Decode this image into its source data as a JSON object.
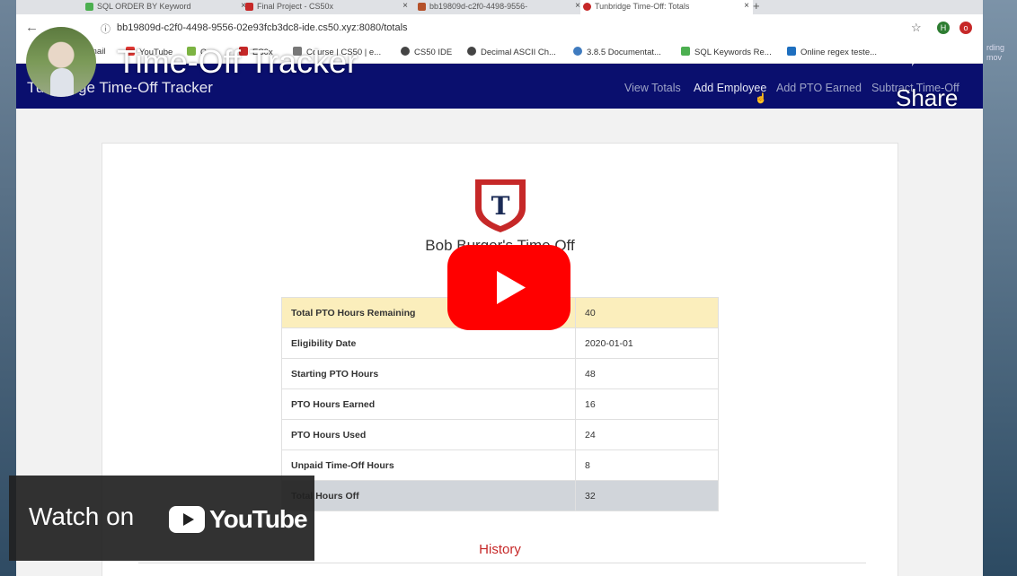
{
  "browser": {
    "tabs": [
      {
        "label": "SQL ORDER BY Keyword"
      },
      {
        "label": "Final Project - CS50x"
      },
      {
        "label": "bb19809d-c2f0-4498-9556-"
      },
      {
        "label": "Tunbridge Time-Off: Totals"
      }
    ],
    "url": "bb19809d-c2f0-4498-9556-02e93fcb3dc8-ide.cs50.xyz:8080/totals",
    "profile_initial": "H",
    "bookmarks": [
      {
        "label": "mail"
      },
      {
        "label": "YouTube"
      },
      {
        "label": "C"
      },
      {
        "label": "ES0x"
      },
      {
        "label": "Course | CS50 | e..."
      },
      {
        "label": "CS50 IDE"
      },
      {
        "label": "Decimal ASCII Ch..."
      },
      {
        "label": "3.8.5 Documentat..."
      },
      {
        "label": "SQL Keywords Re..."
      },
      {
        "label": "Online regex teste..."
      }
    ]
  },
  "site": {
    "brand": "Tunbridge Time-Off Tracker",
    "nav": [
      {
        "label": "View Totals"
      },
      {
        "label": "Add Employee"
      },
      {
        "label": "Add PTO Earned"
      },
      {
        "label": "Subtract Time-Off"
      }
    ],
    "logo_letter": "T",
    "employee_heading": "Bob Burger's Time Off",
    "rows": [
      {
        "label": "Total PTO Hours Remaining",
        "value": "40"
      },
      {
        "label": "Eligibility Date",
        "value": "2020-01-01"
      },
      {
        "label": "Starting PTO Hours",
        "value": "48"
      },
      {
        "label": "PTO Hours Earned",
        "value": "16"
      },
      {
        "label": "PTO Hours Used",
        "value": "24"
      },
      {
        "label": "Unpaid Time-Off Hours",
        "value": "8"
      },
      {
        "label": "Total Hours Off",
        "value": "32"
      }
    ],
    "history_heading": "History"
  },
  "desktop": {
    "side_text": "rding mov"
  },
  "youtube": {
    "video_title": "Time-Off Tracker",
    "share_label": "Share",
    "watch_on": "Watch on",
    "logo_text": "YouTube"
  },
  "colors": {
    "nav_bg": "#0a0f6e",
    "youtube_red": "#ff0000",
    "history_red": "#c62828",
    "highlight_row": "#fbeebc",
    "total_row": "#d1d5da"
  }
}
